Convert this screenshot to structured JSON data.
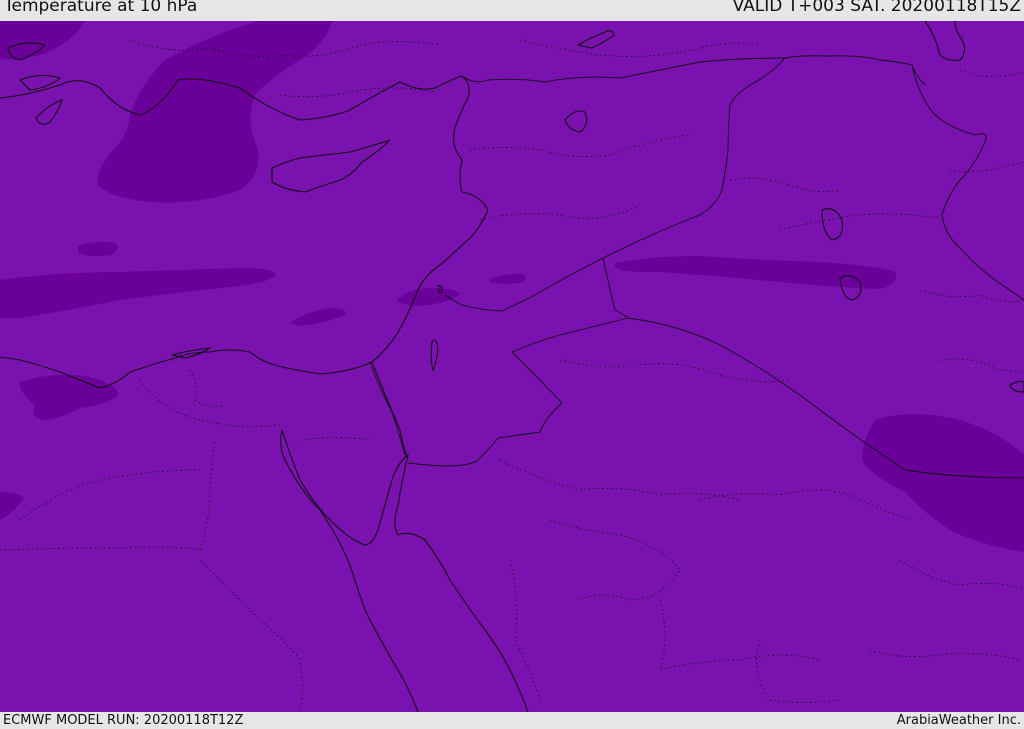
{
  "header": {
    "title": "Temperature at 10 hPa",
    "valid": "VALID T+003 SAT. 20200118T15Z"
  },
  "footer": {
    "model_run": "ECMWF MODEL RUN: 20200118T12Z",
    "credit": "ArabiaWeather Inc."
  },
  "colors": {
    "field_base": "#7a12b0",
    "field_cold": "#6a0099",
    "coastline": "#111111",
    "border": "#111111",
    "bar_bg": "#e6e6e6"
  }
}
